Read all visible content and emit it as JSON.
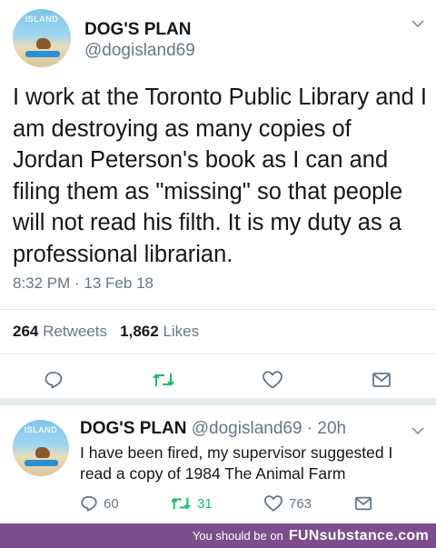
{
  "tweet1": {
    "avatar_text": "ISLAND",
    "display_name": "DOG'S PLAN",
    "handle": "@dogisland69",
    "text": "I work at the Toronto Public Library and I am destroying as many copies of Jordan Peterson's book as I can and filing them as \"missing\" so that people will not read his filth. It is my duty as a professional librarian.",
    "timestamp": "8:32 PM · 13 Feb 18",
    "retweets_count": "264",
    "retweets_label": "Retweets",
    "likes_count": "1,862",
    "likes_label": "Likes"
  },
  "tweet2": {
    "avatar_text": "ISLAND",
    "display_name": "DOG'S PLAN",
    "handle": "@dogisland69",
    "time_ago": "· 20h",
    "text": "I have been fired, my supervisor suggested I read a copy of 1984 The Animal Farm",
    "replies": "60",
    "retweets": "31",
    "likes": "763"
  },
  "footer": {
    "prefix": "You should be on",
    "site": "FUNsubstance.com"
  },
  "colors": {
    "retweet_green": "#17bf63",
    "icon_gray": "#657786",
    "footer_purple": "#7e4d8e"
  },
  "icons": [
    "chevron-down-icon",
    "reply-icon",
    "retweet-icon",
    "like-icon",
    "share-icon"
  ]
}
